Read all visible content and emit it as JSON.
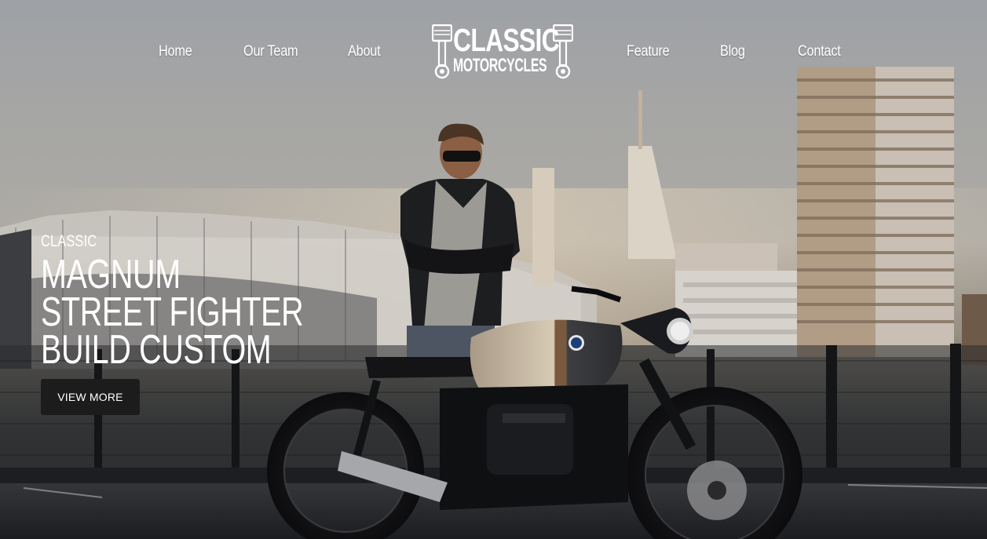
{
  "nav": {
    "left": [
      "Home",
      "Our Team",
      "About"
    ],
    "right": [
      "Feature",
      "Blog",
      "Contact"
    ]
  },
  "logo": {
    "line1": "CLASSIC",
    "line2": "MOTORCYCLES"
  },
  "hero": {
    "eyebrow": "CLASSIC",
    "headline": [
      "MAGNUM",
      "STREET FIGHTER",
      "BUILD CUSTOM"
    ],
    "button_label": "VIEW MORE",
    "background": "hero-photo-man-with-cafe-racer-motorcycle"
  },
  "colors": {
    "text": "#ffffff",
    "button_bg": "#1c1c1c"
  }
}
